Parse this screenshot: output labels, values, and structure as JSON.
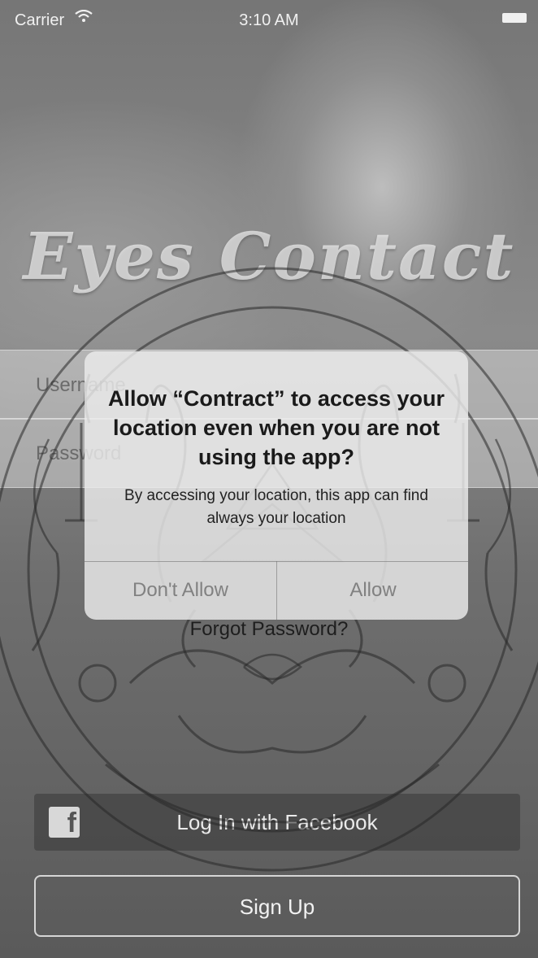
{
  "status_bar": {
    "carrier": "Carrier",
    "time": "3:10 AM"
  },
  "app": {
    "logo_text": "Eyes Contact"
  },
  "login_form": {
    "username_placeholder": "Username",
    "password_placeholder": "Password",
    "forgot_password": "Forgot Password?"
  },
  "buttons": {
    "facebook_login": "Log In with Facebook",
    "sign_up": "Sign Up"
  },
  "alert": {
    "title": "Allow “Contract” to access your location even when you are not using the app?",
    "message": "By accessing your location, this app can find always your location",
    "dont_allow": "Don't Allow",
    "allow": "Allow"
  },
  "icons": {
    "wifi": "wifi-icon",
    "battery": "battery-icon",
    "facebook": "facebook-icon",
    "seal": "seal-watermark"
  }
}
